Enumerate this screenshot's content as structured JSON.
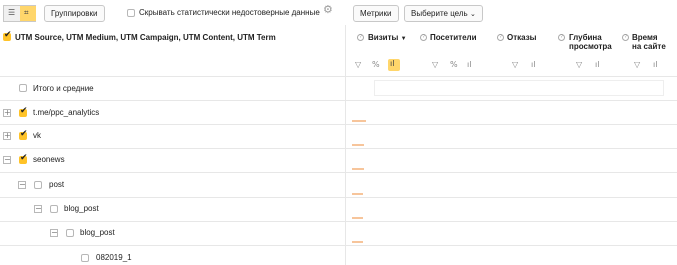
{
  "toolbar": {
    "groupings_label": "Группировки",
    "hide_unreliable_label": "Скрывать статистически недостоверные данные",
    "metrics_label": "Метрики",
    "choose_goal_label": "Выберите цель"
  },
  "table": {
    "dimension_header": "UTM Source, UTM Medium, UTM Campaign, UTM Content, UTM Term",
    "columns": [
      {
        "label_1": "Визиты",
        "label_2": "",
        "sort": "▼"
      },
      {
        "label_1": "Посетители",
        "label_2": ""
      },
      {
        "label_1": "Отказы",
        "label_2": ""
      },
      {
        "label_1": "Глубина",
        "label_2": "просмотра"
      },
      {
        "label_1": "Время",
        "label_2": "на сайте"
      }
    ],
    "totals_label": "Итого и средние",
    "rows": [
      {
        "label": "t.me/ppc_analytics",
        "expander": "+",
        "checked": true
      },
      {
        "label": "vk",
        "expander": "+",
        "checked": true
      },
      {
        "label": "seonews",
        "expander": "−",
        "checked": true
      },
      {
        "label": "post",
        "expander": "−",
        "checked": false
      },
      {
        "label": "blog_post",
        "expander": "−",
        "checked": false
      },
      {
        "label": "blog_post",
        "expander": "−",
        "checked": false
      },
      {
        "label": "082019_1",
        "expander": "",
        "checked": false
      }
    ]
  },
  "colors": {
    "accent": "#ffc328",
    "bar": "#f4b27a",
    "border": "#e7e7e7"
  }
}
